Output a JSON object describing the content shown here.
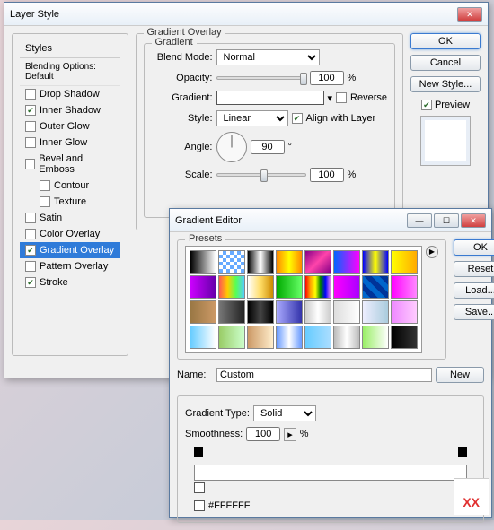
{
  "layerStyle": {
    "title": "Layer Style",
    "listHeader": "Styles",
    "blendingDefault": "Blending Options: Default",
    "items": [
      {
        "label": "Drop Shadow",
        "checked": false
      },
      {
        "label": "Inner Shadow",
        "checked": true
      },
      {
        "label": "Outer Glow",
        "checked": false
      },
      {
        "label": "Inner Glow",
        "checked": false
      },
      {
        "label": "Bevel and Emboss",
        "checked": false
      },
      {
        "label": "Contour",
        "checked": false,
        "indent": true
      },
      {
        "label": "Texture",
        "checked": false,
        "indent": true
      },
      {
        "label": "Satin",
        "checked": false
      },
      {
        "label": "Color Overlay",
        "checked": false
      },
      {
        "label": "Gradient Overlay",
        "checked": true,
        "selected": true
      },
      {
        "label": "Pattern Overlay",
        "checked": false
      },
      {
        "label": "Stroke",
        "checked": true
      }
    ],
    "panel": {
      "title": "Gradient Overlay",
      "subTitle": "Gradient",
      "blendModeLbl": "Blend Mode:",
      "blendMode": "Normal",
      "opacityLbl": "Opacity:",
      "opacity": "100",
      "pct": "%",
      "gradientLbl": "Gradient:",
      "reverseLbl": "Reverse",
      "styleLbl": "Style:",
      "style": "Linear",
      "alignLbl": "Align with Layer",
      "angleLbl": "Angle:",
      "angle": "90",
      "deg": "°",
      "scaleLbl": "Scale:",
      "scale": "100"
    },
    "buttons": {
      "ok": "OK",
      "cancel": "Cancel",
      "newStyle": "New Style...",
      "previewLbl": "Preview"
    }
  },
  "gradientEditor": {
    "title": "Gradient Editor",
    "presetsLbl": "Presets",
    "presets": [
      "linear-gradient(90deg,#000,#fff)",
      "repeating-conic-gradient(#6af 0 25%,#fff 0 50%) 0/8px 8px",
      "linear-gradient(90deg,#000,#fff,#000)",
      "linear-gradient(90deg,#f80,#ff0,#f80)",
      "linear-gradient(135deg,#808,#f4a,#808)",
      "linear-gradient(90deg,#06f,#f0f)",
      "linear-gradient(90deg,#00f,#ff0,#00f)",
      "linear-gradient(90deg,#ff0,#fa0)",
      "linear-gradient(90deg,#c0f,#60a)",
      "linear-gradient(90deg,#f55,#fc0,#5f5,#5cf)",
      "linear-gradient(90deg,#fff,#fd6,#c80)",
      "linear-gradient(90deg,#0a0,#6f6)",
      "linear-gradient(90deg,red,orange,yellow,green,blue,violet)",
      "linear-gradient(90deg,#f0f,#a0f)",
      "repeating-linear-gradient(45deg,#06c 0 6px,#039 0 12px)",
      "linear-gradient(90deg,#f0f,#f8f)",
      "linear-gradient(90deg,#974,#c96)",
      "linear-gradient(90deg,#777,#222)",
      "linear-gradient(90deg,#000,#444,#000)",
      "linear-gradient(90deg,#aaf,#33a)",
      "linear-gradient(90deg,#ccc,#fff,#ccc)",
      "linear-gradient(90deg,#ddd,#fff)",
      "linear-gradient(90deg,#eef,#acd)",
      "linear-gradient(90deg,#e8f,#fcf)",
      "linear-gradient(90deg,#6cf,#fff)",
      "linear-gradient(90deg,#9c6,#cfc)",
      "linear-gradient(90deg,#c96,#fec)",
      "linear-gradient(90deg,#69f,#fff,#69f)",
      "linear-gradient(90deg,#6cf,#adf)",
      "linear-gradient(90deg,#bbb,#fff,#bbb)",
      "linear-gradient(90deg,#9e6,#fff)",
      "linear-gradient(90deg,#000,#333)"
    ],
    "nameLbl": "Name:",
    "name": "Custom",
    "typeLbl": "Gradient Type:",
    "type": "Solid",
    "smoothLbl": "Smoothness:",
    "smooth": "100",
    "pct": "%",
    "colorHex": "#FFFFFF",
    "buttons": {
      "ok": "OK",
      "reset": "Reset",
      "load": "Load...",
      "save": "Save...",
      "newBtn": "New"
    }
  },
  "watermark": "XX"
}
